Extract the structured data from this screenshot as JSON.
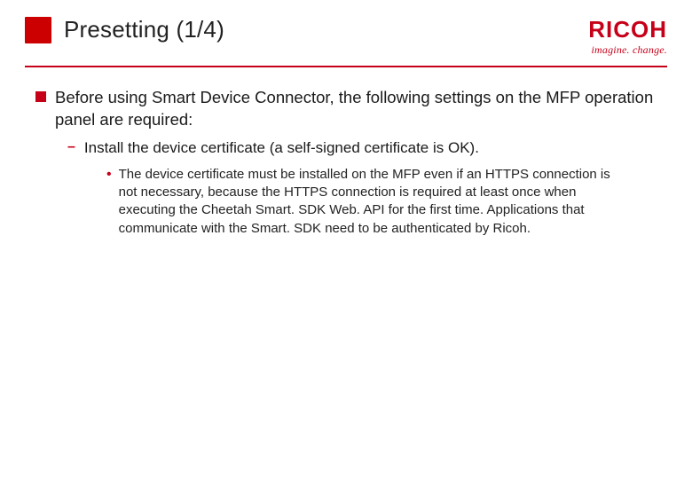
{
  "header": {
    "title": "Presetting (1/4)",
    "logo_text": "RICOH",
    "logo_tagline": "imagine. change."
  },
  "bullets": {
    "lvl1": "Before using Smart Device Connector, the following settings on the MFP operation panel are required:",
    "lvl2": "Install the device certificate (a self-signed certificate is OK).",
    "lvl3": "The device certificate must be installed on the MFP even if an HTTPS connection is not necessary, because the HTTPS connection is required at least once when executing the Cheetah Smart. SDK Web. API for the first time. Applications that communicate with the Smart. SDK need to be authenticated by Ricoh."
  },
  "colors": {
    "brand_red": "#c60019"
  }
}
